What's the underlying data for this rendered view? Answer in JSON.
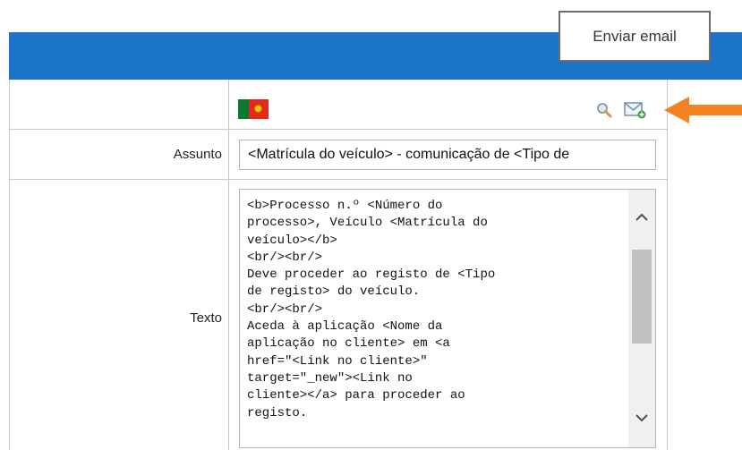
{
  "tooltip": {
    "text": "Enviar email"
  },
  "toolbar": {
    "language_flag": "portugal-flag",
    "search_icon": "magnifier-icon",
    "send_email_icon": "envelope-icon"
  },
  "form": {
    "subject_label": "Assunto",
    "subject_value": "<Matrícula do veículo> - comunicação de <Tipo de",
    "text_label": "Texto",
    "text_value": "<b>Processo n.º <Número do\nprocesso>, Veículo <Matrícula do\nveículo></b>\n<br/><br/>\nDeve proceder ao registo de <Tipo\nde registo> do veículo.\n<br/><br/>\nAceda à aplicação <Nome da\naplicação no cliente> em <a\nhref=\"<Link no cliente>\"\ntarget=\"_new\"><Link no\ncliente></a> para proceder ao\nregisto."
  },
  "colors": {
    "header_blue": "#1c74c8",
    "arrow_orange": "#f58220"
  }
}
